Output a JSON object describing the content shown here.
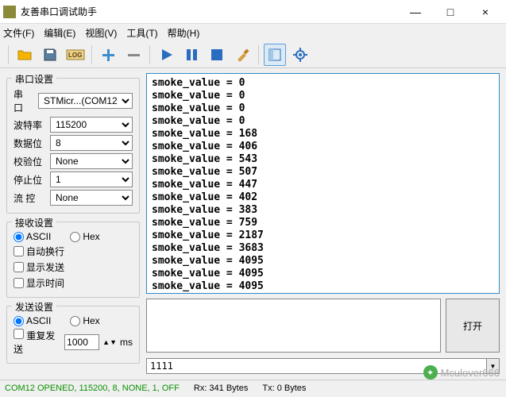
{
  "window": {
    "title": "友善串口调试助手",
    "min": "—",
    "max": "□",
    "close": "×"
  },
  "menu": [
    "文件(F)",
    "编辑(E)",
    "视图(V)",
    "工具(T)",
    "帮助(H)"
  ],
  "serial": {
    "legend": "串口设置",
    "labels": {
      "port": "串  口",
      "baud": "波特率",
      "data": "数据位",
      "parity": "校验位",
      "stop": "停止位",
      "flow": "流  控"
    },
    "values": {
      "port": "STMicr...(COM12",
      "baud": "115200",
      "data": "8",
      "parity": "None",
      "stop": "1",
      "flow": "None"
    }
  },
  "recv": {
    "legend": "接收设置",
    "ascii": "ASCII",
    "hex": "Hex",
    "autowrap": "自动换行",
    "showtx": "显示发送",
    "showtime": "显示时间"
  },
  "send": {
    "legend": "发送设置",
    "ascii": "ASCII",
    "hex": "Hex",
    "repeat": "重复发送",
    "interval": "1000",
    "unit": "ms",
    "button": "打开"
  },
  "rx_lines": [
    "smoke_value = 0",
    "smoke_value = 0",
    "smoke_value = 0",
    "smoke_value = 0",
    "smoke_value = 168",
    "smoke_value = 406",
    "smoke_value = 543",
    "smoke_value = 507",
    "smoke_value = 447",
    "smoke_value = 402",
    "smoke_value = 383",
    "smoke_value = 759",
    "smoke_value = 2187",
    "smoke_value = 3683",
    "smoke_value = 4095",
    "smoke_value = 4095",
    "smoke_value = 4095"
  ],
  "cmd": "1111",
  "status": {
    "conn": "COM12 OPENED, 115200, 8, NONE, 1, OFF",
    "rx": "Rx: 341 Bytes",
    "tx": "Tx: 0 Bytes"
  },
  "watermark": "Mculover666"
}
